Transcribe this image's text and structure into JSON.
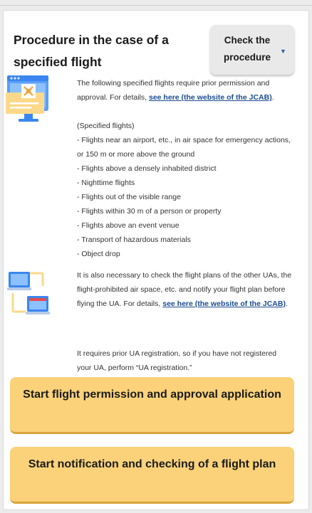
{
  "header": {
    "title": "Procedure in the case of a specified flight",
    "check_button": "Check the procedure",
    "check_caret": "▼"
  },
  "intro": {
    "text": "The following specified flights require prior permission and approval. For details,",
    "link": "see here (the website of the JCAB)",
    "end": "."
  },
  "specified": {
    "heading": "(Specified flights)",
    "items": [
      "- Flights near an airport, etc., in air space for emergency actions, or 150 m or more above the ground",
      "- Flights above a densely inhabited district",
      "- Nighttime flights",
      "- Flights out of the visible range",
      "- Flights within 30 m of a person or property",
      "- Flights above an event venue",
      "- Transport of hazardous materials",
      "- Object drop"
    ]
  },
  "notify": {
    "text": "It is also necessary to check the flight plans of the other UAs, the flight-prohibited air space, etc. and notify your flight plan before flying the UA. For details,",
    "link": "see here (the website of the JCAB)",
    "end": "."
  },
  "registration": {
    "text": "It requires prior UA registration, so if you have not registered your UA, perform “UA registration.”"
  },
  "buttons": {
    "permission": "Start flight permission and approval application",
    "notification": "Start notification and checking of a flight plan"
  },
  "colors": {
    "button_bg": "#fbd27a",
    "link": "#1b4b91",
    "icon_blue": "#3a86f0"
  },
  "icons": [
    "drone-screen-icon",
    "connected-laptops-icon",
    "chevron-down-icon"
  ]
}
